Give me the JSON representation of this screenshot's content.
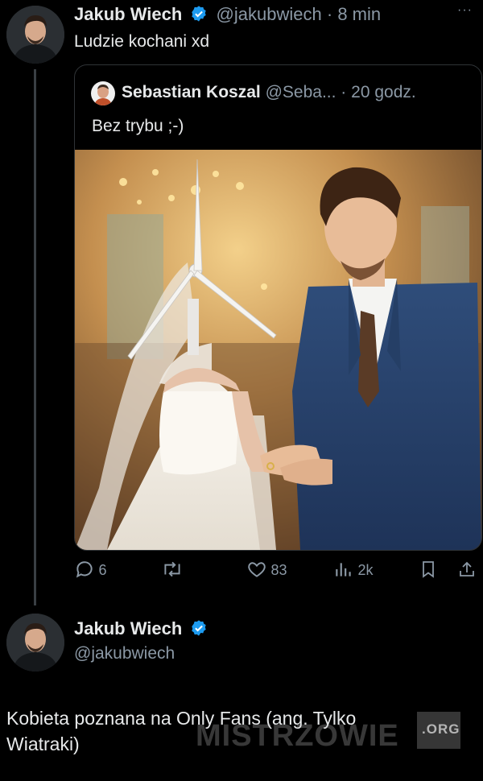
{
  "tweet": {
    "author_name": "Jakub Wiech",
    "handle": "@jakubwiech",
    "separator": "·",
    "time": "8 min",
    "text": "Ludzie kochani xd",
    "more": "···"
  },
  "quoted": {
    "author_name": "Sebastian Koszal",
    "handle": "@Seba...",
    "separator": "·",
    "time": "20 godz.",
    "text": "Bez trybu ;-)"
  },
  "actions": {
    "replies": "6",
    "reposts": "",
    "likes": "83",
    "views": "2k"
  },
  "reply": {
    "author_name": "Jakub Wiech",
    "handle": "@jakubwiech",
    "text": "Kobieta poznana na Only Fans (ang. Tylko Wiatraki)"
  },
  "watermark": {
    "text": "MISTRZOWIE",
    "suffix": ".ORG"
  },
  "colors": {
    "background": "#000000",
    "verified": "#1d9bf0",
    "muted": "#8b98a5"
  }
}
